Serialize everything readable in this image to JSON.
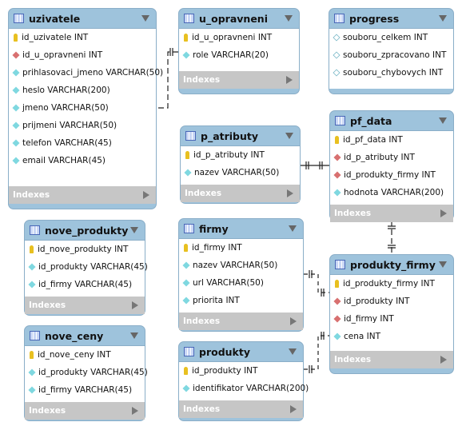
{
  "indexes_label": "Indexes",
  "tables": [
    {
      "id": "uzivatele",
      "name": "uzivatele",
      "columns": [
        {
          "icon": "key",
          "text": "id_uzivatele INT"
        },
        {
          "icon": "fk",
          "text": "id_u_opravneni INT"
        },
        {
          "icon": "col",
          "text": "prihlasovaci_jmeno VARCHAR(50)"
        },
        {
          "icon": "col",
          "text": "heslo VARCHAR(200)"
        },
        {
          "icon": "col",
          "text": "jmeno VARCHAR(50)"
        },
        {
          "icon": "col",
          "text": "prijmeni VARCHAR(50)"
        },
        {
          "icon": "col",
          "text": "telefon VARCHAR(45)"
        },
        {
          "icon": "col",
          "text": "email VARCHAR(45)"
        }
      ]
    },
    {
      "id": "u_opravneni",
      "name": "u_opravneni",
      "columns": [
        {
          "icon": "key",
          "text": "id_u_opravneni INT"
        },
        {
          "icon": "col",
          "text": "role VARCHAR(20)"
        }
      ]
    },
    {
      "id": "progress",
      "name": "progress",
      "no_indexes": true,
      "columns": [
        {
          "icon": "nn",
          "text": "souboru_celkem INT"
        },
        {
          "icon": "nn",
          "text": "souboru_zpracovano INT"
        },
        {
          "icon": "nn",
          "text": "souboru_chybovych INT"
        }
      ]
    },
    {
      "id": "p_atributy",
      "name": "p_atributy",
      "columns": [
        {
          "icon": "key",
          "text": "id_p_atributy INT"
        },
        {
          "icon": "col",
          "text": "nazev VARCHAR(50)"
        }
      ]
    },
    {
      "id": "pf_data",
      "name": "pf_data",
      "columns": [
        {
          "icon": "key",
          "text": "id_pf_data INT"
        },
        {
          "icon": "fk",
          "text": "id_p_atributy INT"
        },
        {
          "icon": "fk",
          "text": "id_produkty_firmy INT"
        },
        {
          "icon": "col",
          "text": "hodnota VARCHAR(200)"
        }
      ]
    },
    {
      "id": "nove_produkty",
      "name": "nove_produkty",
      "columns": [
        {
          "icon": "key",
          "text": "id_nove_produkty INT"
        },
        {
          "icon": "col",
          "text": "id_produkty VARCHAR(45)"
        },
        {
          "icon": "col",
          "text": "id_firmy VARCHAR(45)"
        }
      ]
    },
    {
      "id": "firmy",
      "name": "firmy",
      "columns": [
        {
          "icon": "key",
          "text": "id_firmy INT"
        },
        {
          "icon": "col",
          "text": "nazev VARCHAR(50)"
        },
        {
          "icon": "col",
          "text": "url VARCHAR(50)"
        },
        {
          "icon": "col",
          "text": "priorita INT"
        }
      ]
    },
    {
      "id": "produkty_firmy",
      "name": "produkty_firmy",
      "columns": [
        {
          "icon": "key",
          "text": "id_produkty_firmy INT"
        },
        {
          "icon": "fk",
          "text": "id_produkty INT"
        },
        {
          "icon": "fk",
          "text": "id_firmy INT"
        },
        {
          "icon": "col",
          "text": "cena INT"
        }
      ]
    },
    {
      "id": "nove_ceny",
      "name": "nove_ceny",
      "columns": [
        {
          "icon": "key",
          "text": "id_nove_ceny INT"
        },
        {
          "icon": "col",
          "text": "id_produkty VARCHAR(45)"
        },
        {
          "icon": "col",
          "text": "id_firmy VARCHAR(45)"
        }
      ]
    },
    {
      "id": "produkty",
      "name": "produkty",
      "columns": [
        {
          "icon": "key",
          "text": "id_produkty INT"
        },
        {
          "icon": "col",
          "text": "identifikator VARCHAR(200)"
        }
      ]
    }
  ]
}
